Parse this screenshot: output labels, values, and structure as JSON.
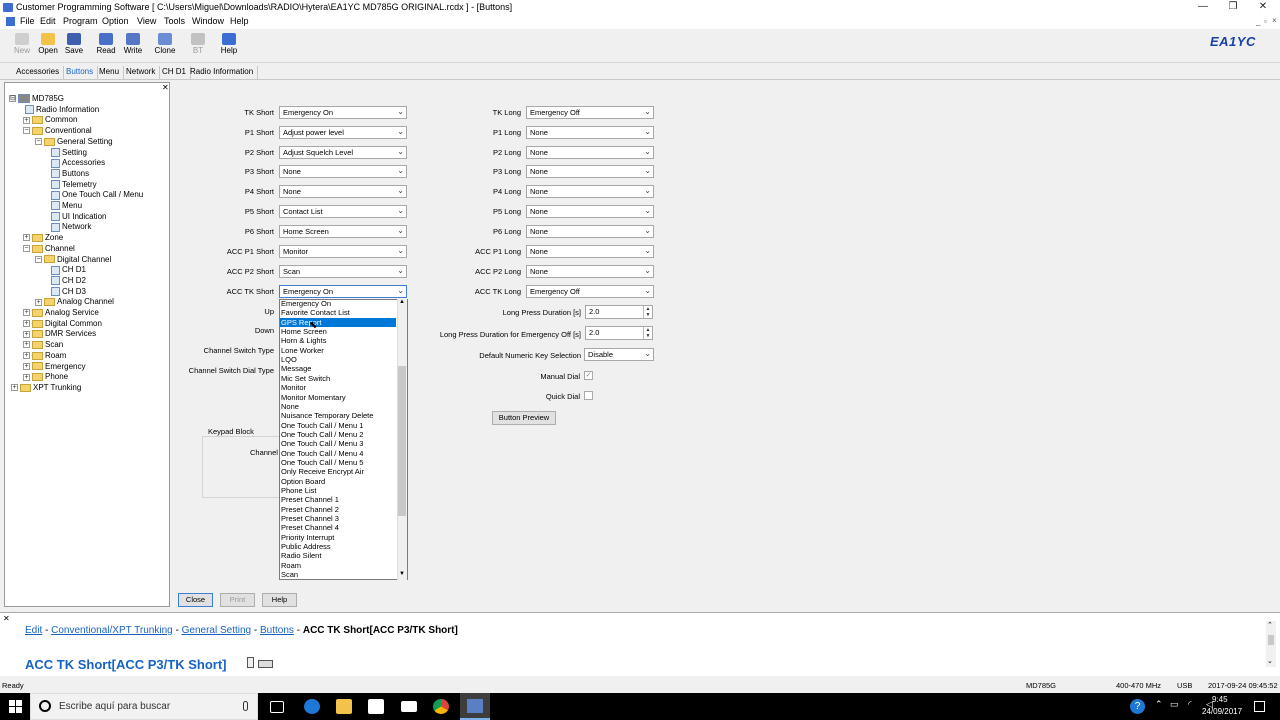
{
  "window": {
    "title": "Customer Programming Software [ C:\\Users\\Miguel\\Downloads\\RADIO\\Hytera\\EA1YC MD785G ORIGINAL.rcdx ] - [Buttons]",
    "minimize": "—",
    "restore": "❐",
    "close": "✕"
  },
  "menu": [
    "File",
    "Edit",
    "Program",
    "Option",
    "View",
    "Tools",
    "Window",
    "Help"
  ],
  "toolbar": {
    "buttons": [
      {
        "label": "New",
        "icon": "new-file-icon",
        "color": "#cfcfcf",
        "enabled": false
      },
      {
        "label": "Open",
        "icon": "open-folder-icon",
        "color": "#f2c24a",
        "enabled": true
      },
      {
        "label": "Save",
        "icon": "floppy-save-icon",
        "color": "#3d5fae",
        "enabled": true
      },
      {
        "label": "Read",
        "icon": "read-radio-icon",
        "color": "#4a6fc7",
        "enabled": true
      },
      {
        "label": "Write",
        "icon": "write-radio-icon",
        "color": "#5577c5",
        "enabled": true
      },
      {
        "label": "Clone",
        "icon": "clone-icon",
        "color": "#6b8dd4",
        "enabled": true
      },
      {
        "label": "BT",
        "icon": "bluetooth-icon",
        "color": "#c2c2c2",
        "enabled": false
      },
      {
        "label": "Help",
        "icon": "help-book-icon",
        "color": "#3b6ed0",
        "enabled": true
      }
    ],
    "brand": "EA1YC"
  },
  "tabs": [
    "Accessories",
    "Buttons",
    "Menu",
    "Network",
    "CH D1",
    "Radio Information"
  ],
  "active_tab": "Buttons",
  "tree": {
    "close": "✕",
    "items": [
      {
        "label": "MD785G",
        "exp": "⊟",
        "type": "root"
      },
      {
        "label": "Radio Information",
        "type": "leaf"
      },
      {
        "label": "Common",
        "exp": "+",
        "type": "folder"
      },
      {
        "label": "Conventional",
        "exp": "−",
        "type": "folder"
      },
      {
        "label": "General Setting",
        "exp": "−",
        "type": "folder"
      },
      {
        "label": "Setting",
        "type": "leaf"
      },
      {
        "label": "Accessories",
        "type": "leaf"
      },
      {
        "label": "Buttons",
        "type": "leaf"
      },
      {
        "label": "Telemetry",
        "type": "leaf"
      },
      {
        "label": "One Touch Call / Menu",
        "type": "leaf"
      },
      {
        "label": "Menu",
        "type": "leaf"
      },
      {
        "label": "UI Indication",
        "type": "leaf"
      },
      {
        "label": "Network",
        "type": "leaf"
      },
      {
        "label": "Zone",
        "exp": "+",
        "type": "folder"
      },
      {
        "label": "Channel",
        "exp": "−",
        "type": "folder"
      },
      {
        "label": "Digital Channel",
        "exp": "−",
        "type": "folder"
      },
      {
        "label": "CH D1",
        "type": "leaf"
      },
      {
        "label": "CH D2",
        "type": "leaf"
      },
      {
        "label": "CH D3",
        "type": "leaf"
      },
      {
        "label": "Analog Channel",
        "exp": "+",
        "type": "folder"
      },
      {
        "label": "Analog Service",
        "exp": "+",
        "type": "folder"
      },
      {
        "label": "Digital Common",
        "exp": "+",
        "type": "folder"
      },
      {
        "label": "DMR Services",
        "exp": "+",
        "type": "folder"
      },
      {
        "label": "Scan",
        "exp": "+",
        "type": "folder"
      },
      {
        "label": "Roam",
        "exp": "+",
        "type": "folder"
      },
      {
        "label": "Emergency",
        "exp": "+",
        "type": "folder"
      },
      {
        "label": "Phone",
        "exp": "+",
        "type": "folder"
      },
      {
        "label": "XPT Trunking",
        "exp": "+",
        "type": "folder"
      }
    ]
  },
  "form": {
    "left": [
      {
        "label": "TK Short",
        "value": "Emergency On"
      },
      {
        "label": "P1 Short",
        "value": "Adjust power level"
      },
      {
        "label": "P2 Short",
        "value": "Adjust Squelch Level"
      },
      {
        "label": "P3 Short",
        "value": "None"
      },
      {
        "label": "P4 Short",
        "value": "None"
      },
      {
        "label": "P5 Short",
        "value": "Contact List"
      },
      {
        "label": "P6 Short",
        "value": "Home Screen"
      },
      {
        "label": "ACC P1 Short",
        "value": "Monitor"
      },
      {
        "label": "ACC P2 Short",
        "value": "Scan"
      },
      {
        "label": "ACC TK Short",
        "value": "Emergency On"
      }
    ],
    "left_extra": [
      "Up",
      "Down",
      "Channel Switch Type",
      "Channel Switch Dial Type"
    ],
    "keypad_block": "Keypad Block",
    "channel": "Channel",
    "right": [
      {
        "label": "TK Long",
        "value": "Emergency Off"
      },
      {
        "label": "P1 Long",
        "value": "None"
      },
      {
        "label": "P2 Long",
        "value": "None"
      },
      {
        "label": "P3 Long",
        "value": "None"
      },
      {
        "label": "P4 Long",
        "value": "None"
      },
      {
        "label": "P5 Long",
        "value": "None"
      },
      {
        "label": "P6 Long",
        "value": "None"
      },
      {
        "label": "ACC P1 Long",
        "value": "None"
      },
      {
        "label": "ACC P2 Long",
        "value": "None"
      },
      {
        "label": "ACC TK Long",
        "value": "Emergency Off"
      }
    ],
    "long_press_label": "Long Press Duration [s]",
    "long_press_value": "2.0",
    "long_press_emerg_label": "Long Press Duration for Emergency Off [s]",
    "long_press_emerg_value": "2.0",
    "numeric_key_label": "Default Numeric Key Selection",
    "numeric_key_value": "Disable",
    "manual_dial_label": "Manual Dial",
    "manual_dial_checked": true,
    "quick_dial_label": "Quick Dial",
    "quick_dial_checked": false,
    "button_preview": "Button Preview",
    "check_mark": "✓",
    "arrow": "⌄"
  },
  "dropdown": {
    "selected_index": 2,
    "items": [
      "Emergency On",
      "Favorite Contact List",
      "GPS Report",
      "Home Screen",
      "Horn & Lights",
      "Lone Worker",
      "LQO",
      "Message",
      "Mic Set Switch",
      "Monitor",
      "Monitor Momentary",
      "None",
      "Nuisance Temporary Delete",
      "One Touch Call / Menu 1",
      "One Touch Call / Menu 2",
      "One Touch Call / Menu 3",
      "One Touch Call / Menu 4",
      "One Touch Call / Menu 5",
      "Only Receive Encrypt Air",
      "Option Board",
      "Phone List",
      "Preset Channel 1",
      "Preset Channel 2",
      "Preset Channel 3",
      "Preset Channel 4",
      "Priority Interrupt",
      "Public Address",
      "Radio Silent",
      "Roam",
      "Scan"
    ]
  },
  "bottom_buttons": {
    "close": "Close",
    "print": "Print",
    "help": "Help"
  },
  "help": {
    "close": "✕",
    "crumbs": [
      "Edit",
      "Conventional/XPT Trunking",
      "General Setting",
      "Buttons"
    ],
    "sep": "-",
    "current": "ACC TK Short[ACC P3/TK Short]",
    "title": "ACC TK Short[ACC P3/TK Short]"
  },
  "status": {
    "left": "Ready",
    "model": "MD785G",
    "band": "400-470 MHz",
    "conn": "USB",
    "datetime": "2017-09-24 09:45:52"
  },
  "taskbar": {
    "search_placeholder": "Escribe aquí para buscar",
    "time": "9:45",
    "date": "24/09/2017"
  }
}
